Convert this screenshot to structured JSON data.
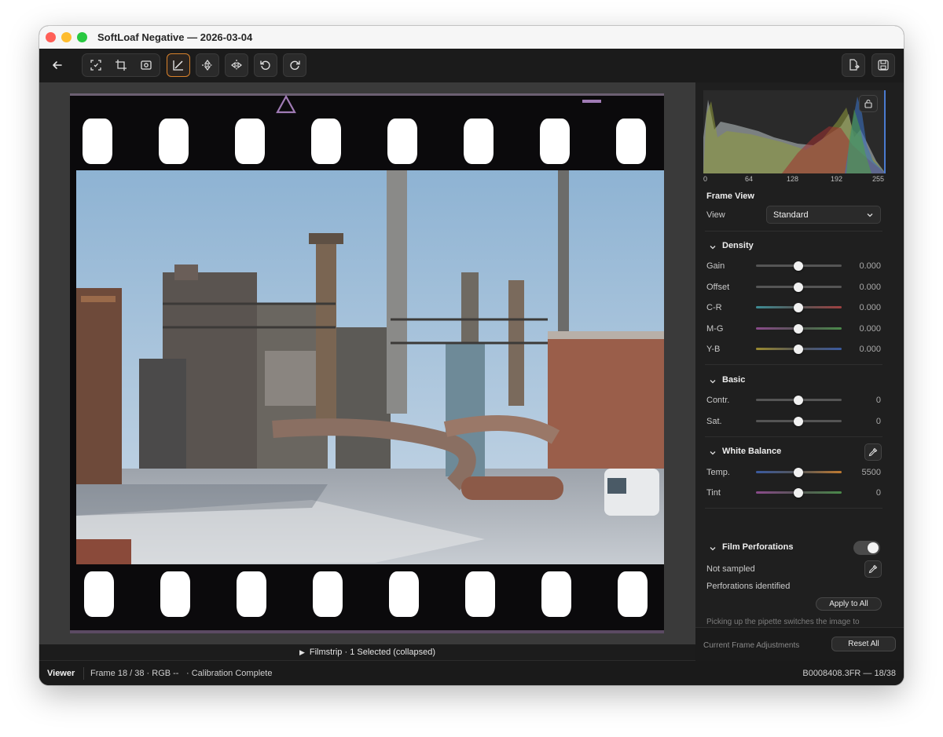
{
  "window": {
    "title": "SoftLoaf Negative — 2026-03-04"
  },
  "toolbar": {
    "buttons": [
      {
        "name": "back",
        "icon": "arrow-left-icon"
      },
      {
        "name": "auto-frame",
        "icon": "auto-frame-icon"
      },
      {
        "name": "crop",
        "icon": "crop-icon"
      },
      {
        "name": "focus",
        "icon": "focus-icon"
      },
      {
        "name": "curves",
        "icon": "curve-icon",
        "active": true
      },
      {
        "name": "flip-vertical",
        "icon": "flip-vertical-icon"
      },
      {
        "name": "flip-horizontal",
        "icon": "flip-horizontal-icon"
      },
      {
        "name": "rotate-left",
        "icon": "rotate-left-icon"
      },
      {
        "name": "rotate-right",
        "icon": "rotate-right-icon"
      },
      {
        "name": "export",
        "icon": "export-icon"
      },
      {
        "name": "save",
        "icon": "save-icon"
      }
    ],
    "active_color": "#d9822b"
  },
  "filmstrip": {
    "label": "Filmstrip · 1 Selected (collapsed)"
  },
  "status": {
    "mode": "Viewer",
    "frame_info": "Frame 18 / 38 · RGB --",
    "calibration": "· Calibration Complete",
    "file": "B0008408.3FR — 18/38"
  },
  "histogram": {
    "ticks": [
      "0",
      "64",
      "128",
      "192",
      "255"
    ]
  },
  "frame_view": {
    "title": "Frame View",
    "view_label": "View",
    "view_value": "Standard"
  },
  "density": {
    "title": "Density",
    "sliders": [
      {
        "label": "Gain",
        "value": "0.000",
        "pos": 0.5
      },
      {
        "label": "Offset",
        "value": "0.000",
        "pos": 0.5
      },
      {
        "label": "C-R",
        "value": "0.000",
        "pos": 0.5
      },
      {
        "label": "M-G",
        "value": "0.000",
        "pos": 0.5
      },
      {
        "label": "Y-B",
        "value": "0.000",
        "pos": 0.5
      }
    ]
  },
  "basic": {
    "title": "Basic",
    "sliders": [
      {
        "label": "Contr.",
        "value": "0",
        "pos": 0.5
      },
      {
        "label": "Sat.",
        "value": "0",
        "pos": 0.5
      }
    ]
  },
  "white_balance": {
    "title": "White Balance",
    "sliders": [
      {
        "label": "Temp.",
        "value": "5500",
        "pos": 0.5
      },
      {
        "label": "Tint",
        "value": "0",
        "pos": 0.5
      }
    ]
  },
  "film_perforations": {
    "title": "Film Perforations",
    "enabled": true,
    "sample_status": "Not sampled",
    "identified": "Perforations identified",
    "apply_all": "Apply to All",
    "hint": "Picking up the pipette switches the image to technical-linear transmittance. Enter confirms the samples; Esc cancels them."
  },
  "footer": {
    "current_adjustments": "Current Frame Adjustments",
    "reset_all": "Reset All"
  }
}
